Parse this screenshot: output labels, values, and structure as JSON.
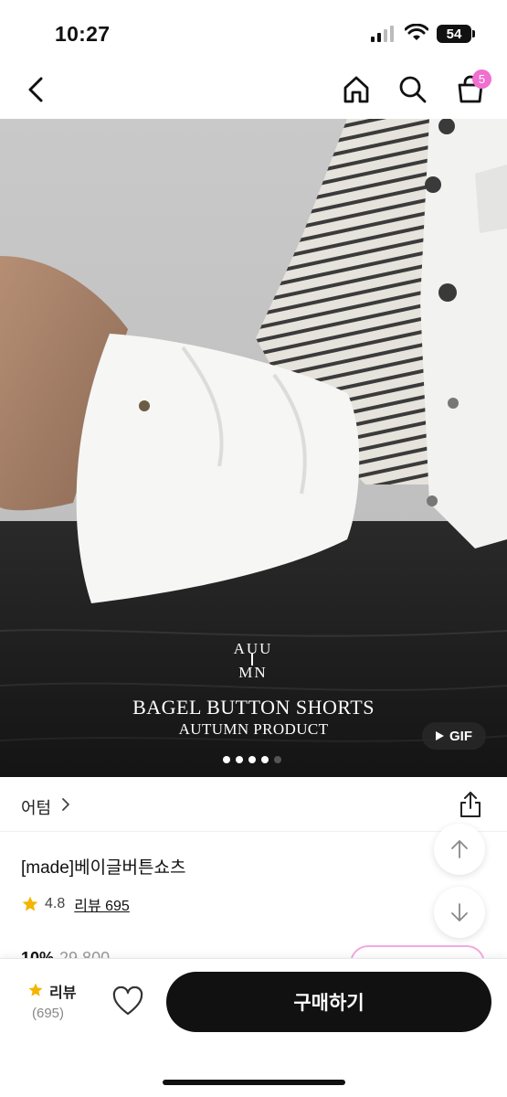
{
  "status_bar": {
    "time": "10:27",
    "battery": "54"
  },
  "nav": {
    "cart_count": "5",
    "icons": [
      "back-icon",
      "home-icon",
      "search-icon",
      "cart-icon"
    ]
  },
  "hero": {
    "title": "BAGEL BUTTON SHORTS",
    "subtitle": "AUTUMN PRODUCT",
    "logo_top": "AUU",
    "logo_bottom": "MN",
    "gif_label": "GIF",
    "carousel": {
      "total": 5,
      "active": 4
    }
  },
  "product": {
    "brand": "어텀",
    "name": "[made]베이글버튼쇼츠",
    "rating": "4.8",
    "review_link": "리뷰 695",
    "discount": "10%",
    "original_price": "29,800"
  },
  "bottom_bar": {
    "review_label": "리뷰",
    "review_count": "(695)",
    "buy_label": "구매하기"
  },
  "colors": {
    "accent": "#f06fcf",
    "star": "#f4b400",
    "buy_button": "#111111"
  }
}
